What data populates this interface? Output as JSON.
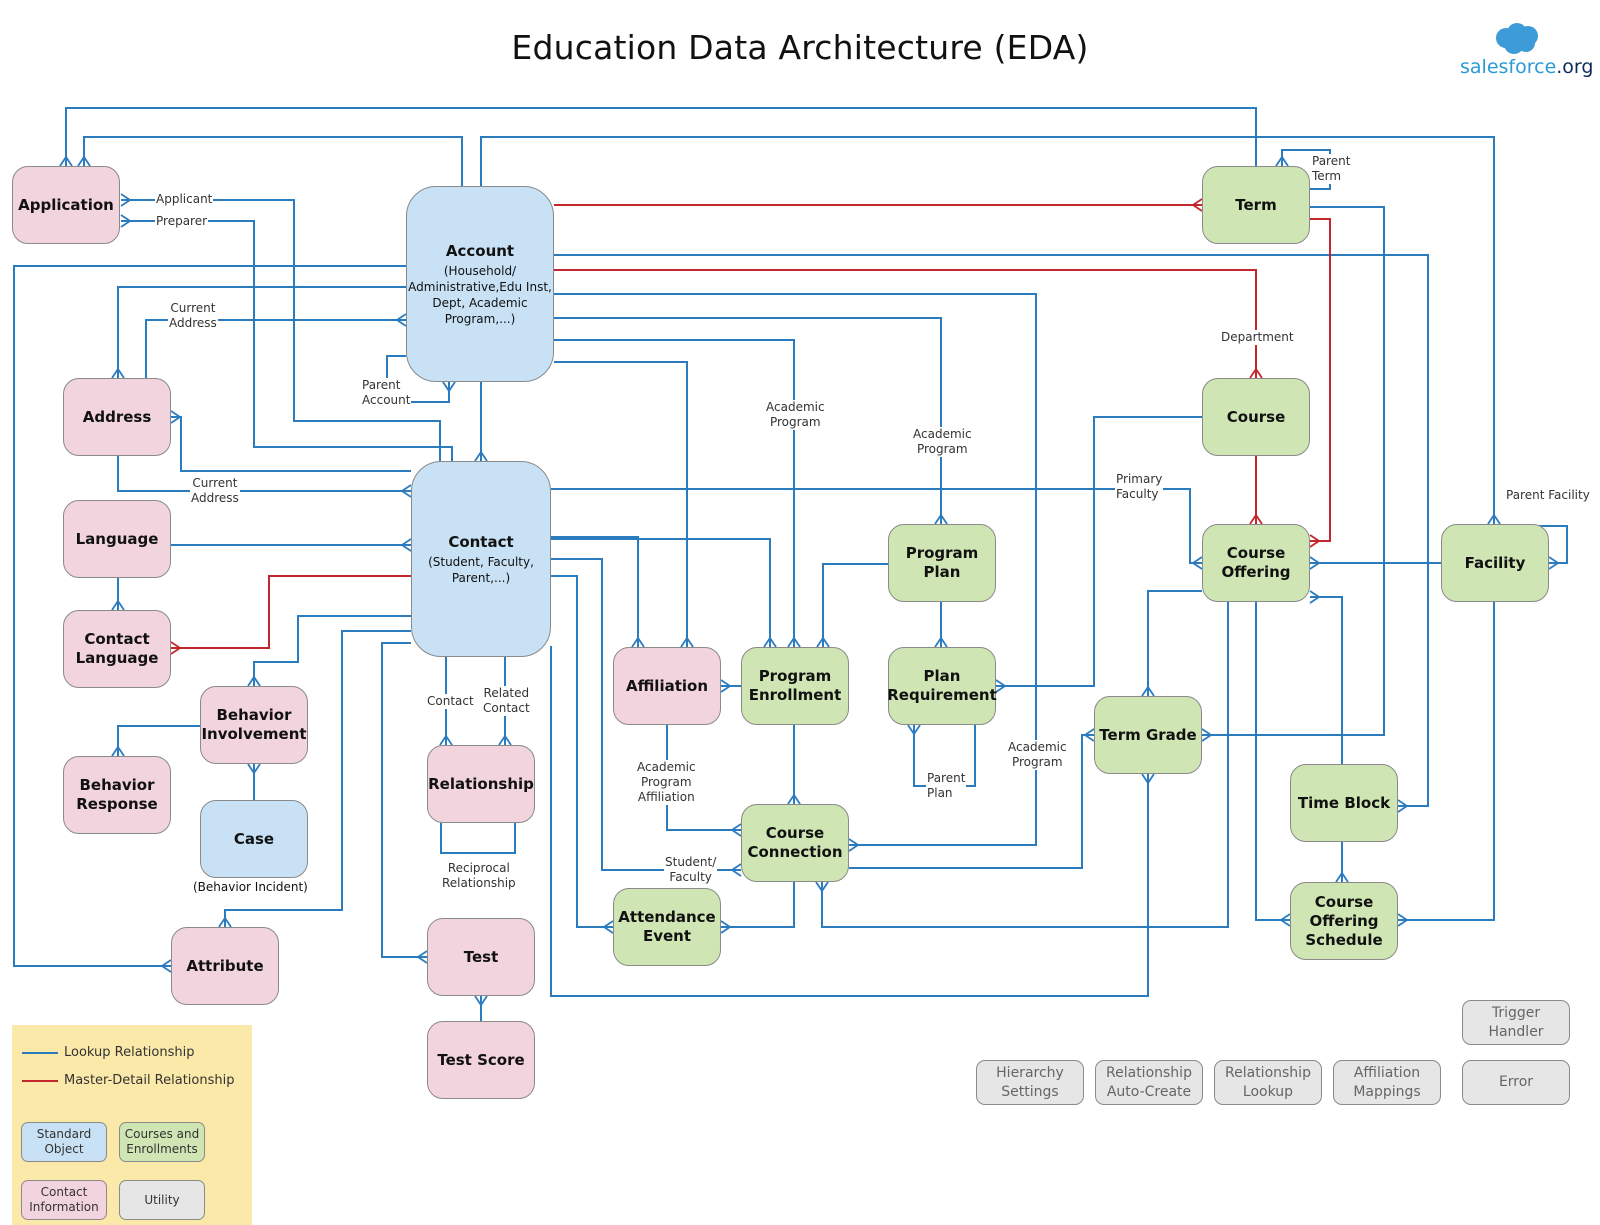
{
  "title": "Education Data Architecture (EDA)",
  "logo": {
    "brand": "salesforce",
    "suffix": ".org",
    "icon": "cloud-icon"
  },
  "colors": {
    "lookup": "#2b7bbf",
    "master_detail": "#c1272d",
    "standard_object": "#c8e1f4",
    "courses_enrollments": "#cfe5b3",
    "contact_information": "#f2d4de",
    "utility": "#e6e6e6",
    "legend_bg": "#fbe9aa"
  },
  "nodes": {
    "application": {
      "name": "Application",
      "category": "contact_information"
    },
    "account": {
      "name": "Account",
      "subtitle": "(Household/\nAdministrative,Edu Inst,\nDept, Academic\nProgram,...)",
      "category": "standard_object"
    },
    "address": {
      "name": "Address",
      "category": "contact_information"
    },
    "contact": {
      "name": "Contact",
      "subtitle": "(Student, Faculty,\nParent,...)",
      "category": "standard_object"
    },
    "language": {
      "name": "Language",
      "category": "contact_information"
    },
    "contact_language": {
      "name": "Contact\nLanguage",
      "category": "contact_information"
    },
    "behavior_involvement": {
      "name": "Behavior\nInvolvement",
      "category": "contact_information"
    },
    "behavior_response": {
      "name": "Behavior\nResponse",
      "category": "contact_information"
    },
    "case": {
      "name": "Case",
      "caption": "(Behavior Incident)",
      "category": "standard_object"
    },
    "attribute": {
      "name": "Attribute",
      "category": "contact_information"
    },
    "relationship": {
      "name": "Relationship",
      "category": "contact_information"
    },
    "test": {
      "name": "Test",
      "category": "contact_information"
    },
    "test_score": {
      "name": "Test Score",
      "category": "contact_information"
    },
    "affiliation": {
      "name": "Affiliation",
      "category": "contact_information"
    },
    "program_enrollment": {
      "name": "Program\nEnrollment",
      "category": "courses_enrollments"
    },
    "program_plan": {
      "name": "Program\nPlan",
      "category": "courses_enrollments"
    },
    "plan_requirement": {
      "name": "Plan\nRequirement",
      "category": "courses_enrollments"
    },
    "course_connection": {
      "name": "Course\nConnection",
      "category": "courses_enrollments"
    },
    "attendance_event": {
      "name": "Attendance\nEvent",
      "category": "courses_enrollments"
    },
    "term": {
      "name": "Term",
      "category": "courses_enrollments"
    },
    "course": {
      "name": "Course",
      "category": "courses_enrollments"
    },
    "course_offering": {
      "name": "Course\nOffering",
      "category": "courses_enrollments"
    },
    "facility": {
      "name": "Facility",
      "category": "courses_enrollments"
    },
    "term_grade": {
      "name": "Term Grade",
      "category": "courses_enrollments"
    },
    "time_block": {
      "name": "Time Block",
      "category": "courses_enrollments"
    },
    "course_offering_schedule": {
      "name": "Course\nOffering\nSchedule",
      "category": "courses_enrollments"
    },
    "trigger_handler": {
      "name": "Trigger\nHandler",
      "category": "utility"
    },
    "error": {
      "name": "Error",
      "category": "utility"
    },
    "hierarchy_settings": {
      "name": "Hierarchy\nSettings",
      "category": "utility"
    },
    "relationship_auto_create": {
      "name": "Relationship\nAuto-Create",
      "category": "utility"
    },
    "relationship_lookup": {
      "name": "Relationship\nLookup",
      "category": "utility"
    },
    "affiliation_mappings": {
      "name": "Affiliation\nMappings",
      "category": "utility"
    }
  },
  "relationship_labels": {
    "applicant": "Applicant",
    "preparer": "Preparer",
    "account_current_address": "Current\nAddress",
    "parent_account": "Parent\nAccount",
    "contact_current_address": "Current\nAddress",
    "academic_program_pe": "Academic\nProgram",
    "academic_program_pp": "Academic\nProgram",
    "department": "Department",
    "parent_term": "Parent\nTerm",
    "primary_faculty": "Primary\nFaculty",
    "parent_facility": "Parent Facility",
    "rel_contact": "Contact",
    "related_contact": "Related\nContact",
    "reciprocal_relationship": "Reciprocal\nRelationship",
    "academic_program_affiliation": "Academic\nProgram\nAffiliation",
    "student_faculty": "Student/\nFaculty",
    "parent_plan": "Parent\nPlan",
    "academic_program_cc": "Academic\nProgram"
  },
  "relationships": [
    {
      "from": "application",
      "to": "contact",
      "label": "Applicant",
      "type": "lookup"
    },
    {
      "from": "application",
      "to": "contact",
      "label": "Preparer",
      "type": "lookup"
    },
    {
      "from": "application",
      "to": "account",
      "type": "lookup"
    },
    {
      "from": "application",
      "to": "term",
      "type": "lookup"
    },
    {
      "from": "account",
      "to": "account",
      "label": "Parent Account",
      "type": "lookup"
    },
    {
      "from": "account",
      "to": "address",
      "label": "Current Address",
      "type": "lookup"
    },
    {
      "from": "address",
      "to": "account",
      "type": "lookup"
    },
    {
      "from": "address",
      "to": "contact",
      "type": "lookup"
    },
    {
      "from": "contact",
      "to": "address",
      "label": "Current Address",
      "type": "lookup"
    },
    {
      "from": "contact",
      "to": "account",
      "type": "lookup"
    },
    {
      "from": "contact_language",
      "to": "contact",
      "type": "master-detail"
    },
    {
      "from": "contact_language",
      "to": "language",
      "type": "lookup"
    },
    {
      "from": "term",
      "to": "account",
      "type": "master-detail"
    },
    {
      "from": "term",
      "to": "term",
      "label": "Parent Term",
      "type": "lookup"
    },
    {
      "from": "course",
      "to": "account",
      "label": "Department",
      "type": "master-detail"
    },
    {
      "from": "course_offering",
      "to": "course",
      "type": "master-detail"
    },
    {
      "from": "course_offering",
      "to": "term",
      "type": "master-detail"
    },
    {
      "from": "course_offering",
      "to": "contact",
      "label": "Primary Faculty",
      "type": "lookup"
    },
    {
      "from": "course_offering",
      "to": "facility",
      "type": "lookup"
    },
    {
      "from": "facility",
      "to": "facility",
      "label": "Parent Facility",
      "type": "lookup"
    },
    {
      "from": "relationship",
      "to": "contact",
      "label": "Contact",
      "type": "lookup"
    },
    {
      "from": "relationship",
      "to": "contact",
      "label": "Related Contact",
      "type": "lookup"
    },
    {
      "from": "relationship",
      "to": "relationship",
      "label": "Reciprocal Relationship",
      "type": "lookup"
    },
    {
      "from": "program_enrollment",
      "to": "account",
      "label": "Academic Program",
      "type": "lookup"
    },
    {
      "from": "program_plan",
      "to": "account",
      "label": "Academic Program",
      "type": "lookup"
    },
    {
      "from": "plan_requirement",
      "to": "plan_requirement",
      "label": "Parent Plan",
      "type": "lookup"
    },
    {
      "from": "course_connection",
      "to": "affiliation",
      "label": "Academic Program Affiliation",
      "type": "lookup"
    },
    {
      "from": "course_connection",
      "to": "contact",
      "label": "Student/Faculty",
      "type": "lookup"
    },
    {
      "from": "course_connection",
      "to": "account",
      "label": "Academic Program",
      "type": "lookup"
    }
  ],
  "legend": {
    "lookup": "Lookup Relationship",
    "master_detail": "Master-Detail Relationship",
    "standard_object": "Standard\nObject",
    "courses_enrollments": "Courses and\nEnrollments",
    "contact_information": "Contact\nInformation",
    "utility": "Utility"
  }
}
